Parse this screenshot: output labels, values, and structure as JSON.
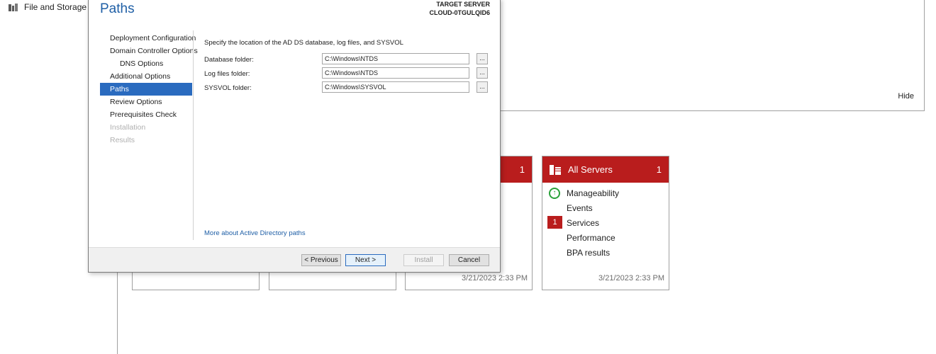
{
  "background": {
    "nav_item_label": "File and Storage Ser",
    "hide_label": "Hide",
    "tile_partial": {
      "count": "1",
      "date": "3/21/2023 2:33 PM"
    },
    "tile_all_servers": {
      "title": "All Servers",
      "count": "1",
      "rows": [
        "Manageability",
        "Events",
        "Services",
        "Performance",
        "BPA results"
      ],
      "services_badge": "1",
      "date": "3/21/2023 2:33 PM"
    }
  },
  "dialog": {
    "title": "Paths",
    "target_label": "TARGET SERVER",
    "target_name": "CLOUD-0TGULQID6",
    "steps": [
      {
        "label": "Deployment Configuration"
      },
      {
        "label": "Domain Controller Options"
      },
      {
        "label": "DNS Options"
      },
      {
        "label": "Additional Options"
      },
      {
        "label": "Paths"
      },
      {
        "label": "Review Options"
      },
      {
        "label": "Prerequisites Check"
      },
      {
        "label": "Installation"
      },
      {
        "label": "Results"
      }
    ],
    "intro": "Specify the location of the AD DS database, log files, and SYSVOL",
    "fields": {
      "database": {
        "label": "Database folder:",
        "value": "C:\\Windows\\NTDS"
      },
      "logs": {
        "label": "Log files folder:",
        "value": "C:\\Windows\\NTDS"
      },
      "sysvol": {
        "label": "SYSVOL folder:",
        "value": "C:\\Windows\\SYSVOL"
      }
    },
    "browse_label": "...",
    "more_link": "More about Active Directory paths",
    "buttons": {
      "previous": "< Previous",
      "next": "Next >",
      "install": "Install",
      "cancel": "Cancel"
    }
  },
  "colors": {
    "accent_red": "#b91d1d",
    "accent_blue": "#2a6bbf",
    "title_blue": "#1f5fa6",
    "ok_green": "#2aa13a"
  }
}
